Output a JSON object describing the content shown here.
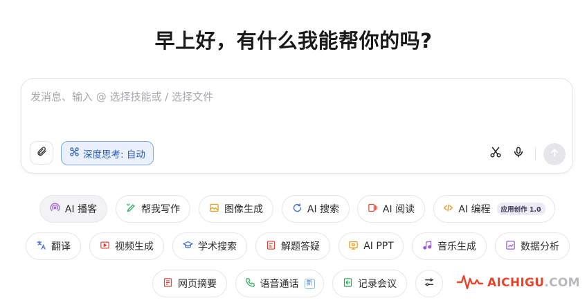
{
  "greeting": "早上好，有什么我能帮你的吗?",
  "composer": {
    "placeholder": "发消息、输入 @ 选择技能或 / 选择文件",
    "deep_think_label": "深度思考: 自动"
  },
  "chips_row1": [
    {
      "label": "AI 播客",
      "icon": "podcast-icon",
      "color": "#9b59d6",
      "active": true
    },
    {
      "label": "帮我写作",
      "icon": "pen-icon",
      "color": "#2eaa5a"
    },
    {
      "label": "图像生成",
      "icon": "image-icon",
      "color": "#e89b1e"
    },
    {
      "label": "AI 搜索",
      "icon": "search-refresh-icon",
      "color": "#3b6fd6"
    },
    {
      "label": "AI 阅读",
      "icon": "reading-icon",
      "color": "#e0453a"
    },
    {
      "label": "AI 编程",
      "icon": "code-icon",
      "color": "#e89b1e",
      "badge": "应用创作 1.0"
    }
  ],
  "chips_row2": [
    {
      "label": "翻译",
      "icon": "translate-icon",
      "color": "#4a6fd6"
    },
    {
      "label": "视频生成",
      "icon": "video-icon",
      "color": "#e0453a"
    },
    {
      "label": "学术搜索",
      "icon": "academic-icon",
      "color": "#3b6fd6"
    },
    {
      "label": "解题答疑",
      "icon": "solve-icon",
      "color": "#e0453a"
    },
    {
      "label": "AI PPT",
      "icon": "ppt-icon",
      "color": "#e89b1e"
    },
    {
      "label": "音乐生成",
      "icon": "music-icon",
      "color": "#9b59d6"
    },
    {
      "label": "数据分析",
      "icon": "data-icon",
      "color": "#9b59d6"
    }
  ],
  "chips_row3": [
    {
      "label": "网页摘要",
      "icon": "webpage-icon",
      "color": "#e0453a"
    },
    {
      "label": "语音通话",
      "icon": "phone-icon",
      "color": "#2eaa5a",
      "new_badge": "新"
    },
    {
      "label": "记录会议",
      "icon": "meeting-icon",
      "color": "#2eaa5a"
    }
  ],
  "watermark": {
    "part1": "AICHIGU",
    "part2": ".COM",
    "color": "#e8452c"
  }
}
